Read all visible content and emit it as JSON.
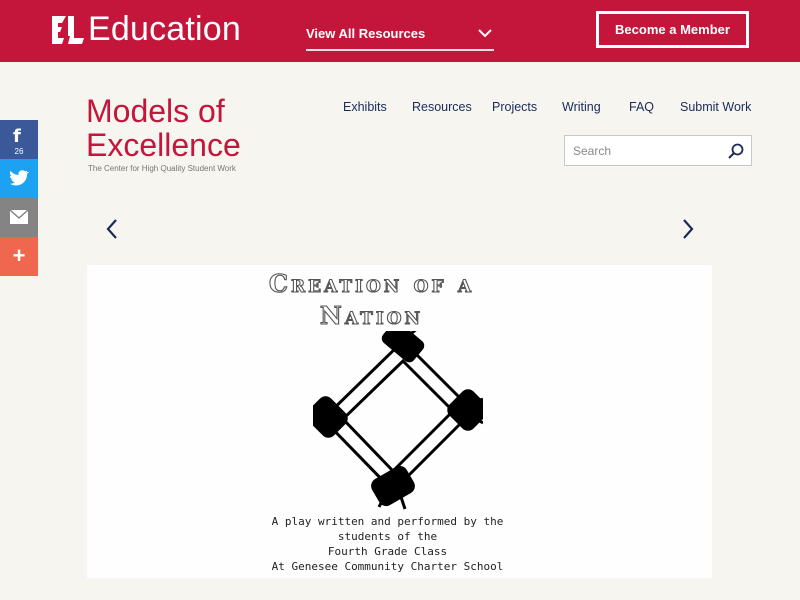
{
  "topbar": {
    "brand": "Education",
    "view_all": "View All Resources",
    "member_button": "Become a Member",
    "bg_color": "#c4153b"
  },
  "logo": {
    "line1": "Models of",
    "line2": "Excellence",
    "tagline": "The Center for High Quality Student Work"
  },
  "nav": [
    {
      "label": "Exhibits"
    },
    {
      "label": "Resources"
    },
    {
      "label": "Projects"
    },
    {
      "label": "Writing"
    },
    {
      "label": "FAQ"
    },
    {
      "label": "Submit Work"
    }
  ],
  "search": {
    "placeholder": "Search",
    "icon": "search-icon"
  },
  "social": {
    "facebook_count": "26",
    "items": [
      "facebook-icon",
      "twitter-icon",
      "email-icon",
      "share-more-icon"
    ]
  },
  "carousel": {
    "prev_icon": "chevron-left-icon",
    "next_icon": "chevron-right-icon"
  },
  "slide": {
    "title_line1": "Creation of a",
    "title_line2": "Nation",
    "caption": [
      "A play written and performed by the",
      "students of the",
      "Fourth Grade Class",
      "At Genesee Community Charter School"
    ]
  }
}
